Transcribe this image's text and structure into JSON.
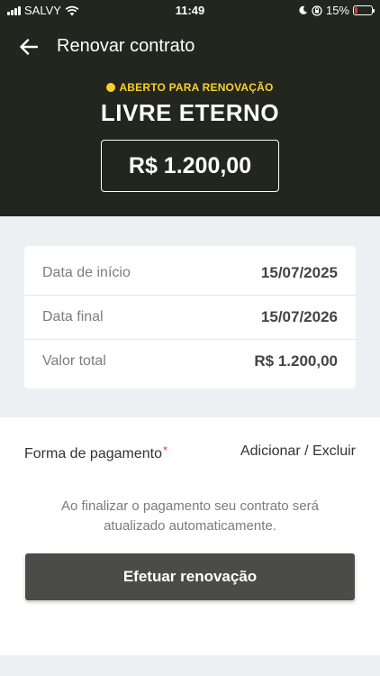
{
  "status_bar": {
    "carrier": "SALVY",
    "time": "11:49",
    "battery": "15%"
  },
  "topbar": {
    "title": "Renovar contrato"
  },
  "plan": {
    "status": "ABERTO PARA RENOVAÇÃO",
    "name": "LIVRE ETERNO",
    "price": "R$ 1.200,00"
  },
  "details": [
    {
      "label": "Data de início",
      "value": "15/07/2025"
    },
    {
      "label": "Data final",
      "value": "15/07/2026"
    },
    {
      "label": "Valor total",
      "value": "R$ 1.200,00"
    }
  ],
  "payment": {
    "label": "Forma de pagamento",
    "required_mark": "*",
    "action": "Adicionar / Excluir"
  },
  "info_text": "Ao finalizar o pagamento seu contrato será atualizado automaticamente.",
  "cta_label": "Efetuar renovação",
  "colors": {
    "header_bg": "#23251f",
    "accent_yellow": "#f5d22b",
    "button_bg": "#4b4c48",
    "page_bg": "#eeeff3"
  }
}
